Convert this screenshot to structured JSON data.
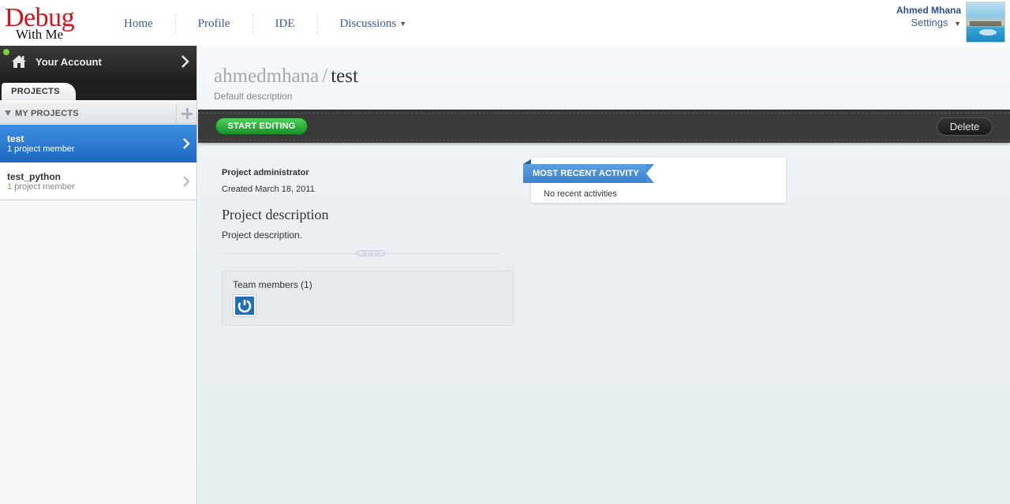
{
  "logo": {
    "line1": "Debug",
    "line2": "With Me"
  },
  "nav": {
    "items": [
      {
        "label": "Home"
      },
      {
        "label": "Profile"
      },
      {
        "label": "IDE"
      },
      {
        "label": "Discussions"
      }
    ]
  },
  "user": {
    "name": "Ahmed Mhana",
    "settings_label": "Settings"
  },
  "sidebar": {
    "account_label": "Your Account",
    "tab_label": "PROJECTS",
    "section_label": "MY PROJECTS",
    "projects": [
      {
        "name": "test",
        "members_count": "1",
        "members_suffix": "project member",
        "subtitle": "1 project member",
        "selected": true
      },
      {
        "name": "test_python",
        "members_count": "1",
        "members_suffix": "project member",
        "selected": false
      }
    ]
  },
  "main": {
    "breadcrumb": {
      "owner": "ahmedmhana",
      "separator": "/",
      "project": "test"
    },
    "default_description": "Default description",
    "toolbar": {
      "start_editing_label": "START EDITING",
      "delete_label": "Delete"
    },
    "admin_label": "Project administrator",
    "created_text": "Created March 18, 2011",
    "description_heading": "Project description",
    "description_text": "Project description.",
    "team_label": "Team members (1)",
    "activity": {
      "title": "MOST RECENT ACTIVITY",
      "empty_text": "No recent activities"
    }
  },
  "colors": {
    "brand_red": "#d2141b",
    "nav_blue": "#3a5b9a",
    "selected_blue": "#1d68c2",
    "start_green": "#17922a",
    "ribbon_blue": "#3b82cf"
  },
  "icons": [
    "house-icon",
    "chevron-right-icon",
    "plus-icon",
    "power-icon",
    "caret-down-icon"
  ]
}
